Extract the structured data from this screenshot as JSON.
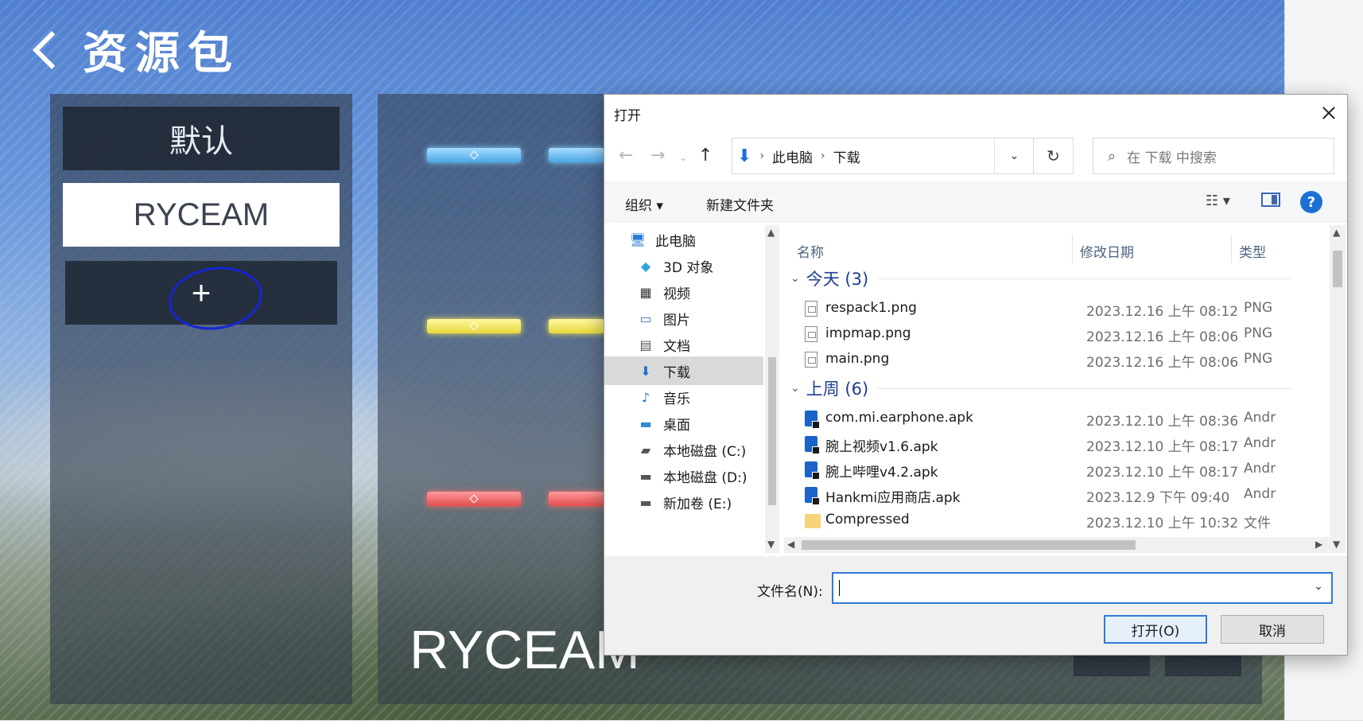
{
  "game": {
    "title": "资源包",
    "packs": [
      "默认",
      "RYCEAM"
    ],
    "add_label": "+",
    "preview_name": "RYCEAM"
  },
  "dialog": {
    "title": "打开",
    "address": [
      "此电脑",
      "下载"
    ],
    "search_placeholder": "在 下载 中搜索",
    "toolbar": {
      "organize": "组织 ▾",
      "new_folder": "新建文件夹"
    },
    "tree": [
      {
        "label": "此电脑",
        "icon": "computer-icon"
      },
      {
        "label": "3D 对象",
        "icon": "cube-icon"
      },
      {
        "label": "视频",
        "icon": "film-icon"
      },
      {
        "label": "图片",
        "icon": "image-icon"
      },
      {
        "label": "文档",
        "icon": "document-icon"
      },
      {
        "label": "下载",
        "icon": "download-icon",
        "selected": true
      },
      {
        "label": "音乐",
        "icon": "music-icon"
      },
      {
        "label": "桌面",
        "icon": "desktop-icon"
      },
      {
        "label": "本地磁盘 (C:)",
        "icon": "drive-c-icon"
      },
      {
        "label": "本地磁盘 (D:)",
        "icon": "drive-icon"
      },
      {
        "label": "新加卷 (E:)",
        "icon": "drive-icon"
      }
    ],
    "columns": [
      "名称",
      "修改日期",
      "类型"
    ],
    "groups": [
      {
        "label": "今天 (3)",
        "files": [
          {
            "name": "respack1.png",
            "date": "2023.12.16 上午 08:12",
            "type": "PNG",
            "icon": "png-file-icon"
          },
          {
            "name": "impmap.png",
            "date": "2023.12.16 上午 08:06",
            "type": "PNG",
            "icon": "png-file-icon"
          },
          {
            "name": "main.png",
            "date": "2023.12.16 上午 08:06",
            "type": "PNG",
            "icon": "png-file-icon"
          }
        ]
      },
      {
        "label": "上周 (6)",
        "files": [
          {
            "name": "com.mi.earphone.apk",
            "date": "2023.12.10 上午 08:36",
            "type": "Andr",
            "icon": "apk-file-icon"
          },
          {
            "name": "腕上视频v1.6.apk",
            "date": "2023.12.10 上午 08:17",
            "type": "Andr",
            "icon": "apk-file-icon"
          },
          {
            "name": "腕上哔哩v4.2.apk",
            "date": "2023.12.10 上午 08:17",
            "type": "Andr",
            "icon": "apk-file-icon"
          },
          {
            "name": "Hankmi应用商店.apk",
            "date": "2023.12.9 下午 09:40",
            "type": "Andr",
            "icon": "apk-file-icon"
          },
          {
            "name": "Compressed",
            "date": "2023.12.10 上午 10:32",
            "type": "文件",
            "icon": "folder-icon"
          }
        ]
      }
    ],
    "filename_label": "文件名(N):",
    "filename_value": "",
    "open_button": "打开(O)",
    "cancel_button": "取消"
  }
}
